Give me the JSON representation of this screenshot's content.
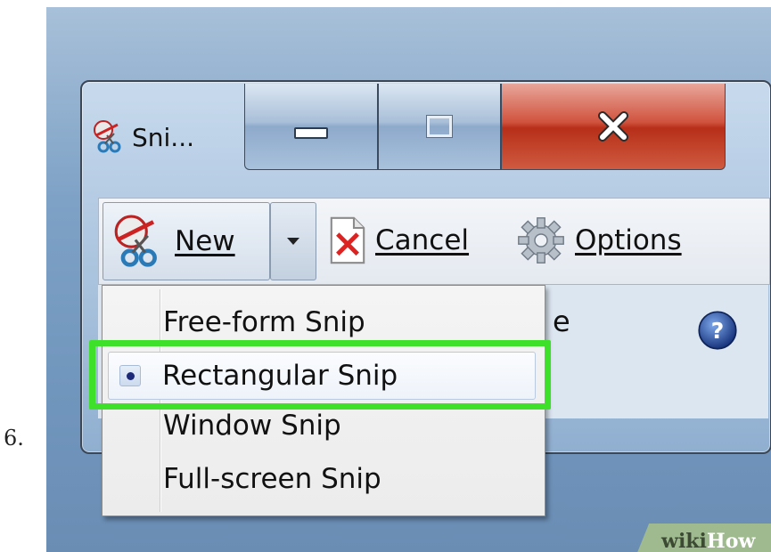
{
  "step": {
    "number": "6."
  },
  "window": {
    "title": "Sni...",
    "caption": {
      "minimize_icon": "minimize-icon",
      "maximize_icon": "maximize-icon",
      "close_icon": "close-icon"
    }
  },
  "toolbar": {
    "new_label": "New",
    "cancel_label": "Cancel",
    "options_label": "Options"
  },
  "content": {
    "partial_text": "e",
    "help_icon": "help-icon"
  },
  "menu": {
    "items": [
      {
        "label": "Free-form Snip",
        "selected": false
      },
      {
        "label": "Rectangular Snip",
        "selected": true
      },
      {
        "label": "Window Snip",
        "selected": false
      },
      {
        "label": "Full-screen Snip",
        "selected": false
      }
    ]
  },
  "highlight": {
    "color": "#3ee029"
  },
  "watermark": {
    "part1": "wiki",
    "part2": "How"
  },
  "colors": {
    "desktop": "#7ea2c6",
    "close_button": "#c0391f",
    "selection_dot": "#1d2a7a"
  }
}
